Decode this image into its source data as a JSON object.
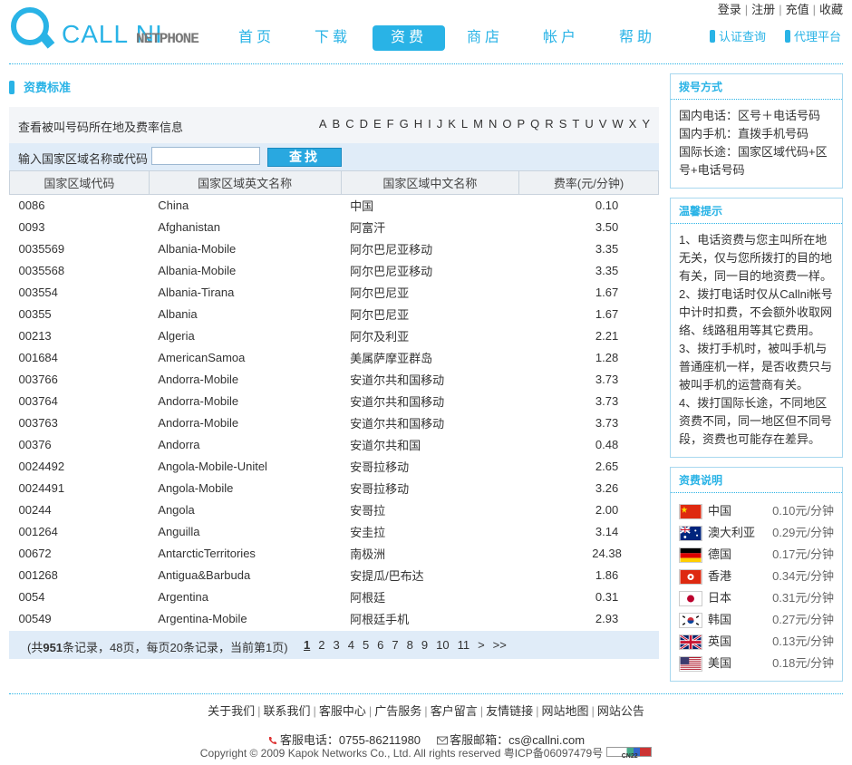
{
  "logo": {
    "text": "CALL NI",
    "sub": "NETPHONE"
  },
  "topnav": [
    "登录",
    "注册",
    "充值",
    "收藏"
  ],
  "mainnav": [
    {
      "label": "首页",
      "active": false
    },
    {
      "label": "下载",
      "active": false
    },
    {
      "label": "资费",
      "active": true
    },
    {
      "label": "商店",
      "active": false
    },
    {
      "label": "帐户",
      "active": false
    },
    {
      "label": "帮助",
      "active": false
    }
  ],
  "quicklinks": [
    "认证查询",
    "代理平台"
  ],
  "main": {
    "title": "资费标准",
    "lookup_label": "查看被叫号码所在地及费率信息",
    "letters": [
      "A",
      "B",
      "C",
      "D",
      "E",
      "F",
      "G",
      "H",
      "I",
      "J",
      "K",
      "L",
      "M",
      "N",
      "O",
      "P",
      "Q",
      "R",
      "S",
      "T",
      "U",
      "V",
      "W",
      "X",
      "Y"
    ],
    "search_label": "输入国家区域名称或代码",
    "search_value": "",
    "search_button": "查找",
    "columns": [
      "国家区域代码",
      "国家区域英文名称",
      "国家区域中文名称",
      "费率(元/分钟)"
    ],
    "rows": [
      [
        "0086",
        "China",
        "中国",
        "0.10"
      ],
      [
        "0093",
        "Afghanistan",
        "阿富汗",
        "3.50"
      ],
      [
        "0035569",
        "Albania-Mobile",
        "阿尔巴尼亚移动",
        "3.35"
      ],
      [
        "0035568",
        "Albania-Mobile",
        "阿尔巴尼亚移动",
        "3.35"
      ],
      [
        "003554",
        "Albania-Tirana",
        "阿尔巴尼亚",
        "1.67"
      ],
      [
        "00355",
        "Albania",
        "阿尔巴尼亚",
        "1.67"
      ],
      [
        "00213",
        "Algeria",
        "阿尔及利亚",
        "2.21"
      ],
      [
        "001684",
        "AmericanSamoa",
        "美属萨摩亚群岛",
        "1.28"
      ],
      [
        "003766",
        "Andorra-Mobile",
        "安道尔共和国移动",
        "3.73"
      ],
      [
        "003764",
        "Andorra-Mobile",
        "安道尔共和国移动",
        "3.73"
      ],
      [
        "003763",
        "Andorra-Mobile",
        "安道尔共和国移动",
        "3.73"
      ],
      [
        "00376",
        "Andorra",
        "安道尔共和国",
        "0.48"
      ],
      [
        "0024492",
        "Angola-Mobile-Unitel",
        "安哥拉移动",
        "2.65"
      ],
      [
        "0024491",
        "Angola-Mobile",
        "安哥拉移动",
        "3.26"
      ],
      [
        "00244",
        "Angola",
        "安哥拉",
        "2.00"
      ],
      [
        "001264",
        "Anguilla",
        "安圭拉",
        "3.14"
      ],
      [
        "00672",
        "AntarcticTerritories",
        "南极洲",
        "24.38"
      ],
      [
        "001268",
        "Antigua&Barbuda",
        "安提瓜/巴布达",
        "1.86"
      ],
      [
        "0054",
        "Argentina",
        "阿根廷",
        "0.31"
      ],
      [
        "00549",
        "Argentina-Mobile",
        "阿根廷手机",
        "2.93"
      ]
    ],
    "pager": {
      "info_prefix": "(共",
      "total": "951",
      "info_suffix": "条记录，48页，每页20条记录，当前第1页)",
      "pages": [
        "1",
        "2",
        "3",
        "4",
        "5",
        "6",
        "7",
        "8",
        "9",
        "10",
        "11",
        ">",
        ">>"
      ],
      "current": "1"
    }
  },
  "sidebar": {
    "dial": {
      "title": "拨号方式",
      "lines": [
        "国内电话：区号＋电话号码",
        "国内手机：直拨手机号码",
        "国际长途：国家区域代码+区号+电话号码"
      ]
    },
    "tips": {
      "title": "温馨提示",
      "lines": [
        "1、电话资费与您主叫所在地无关，仅与您所拨打的目的地有关，同一目的地资费一样。",
        "2、拨打电话时仅从Callni帐号中计时扣费，不会额外收取网络、线路租用等其它费用。",
        "3、拨打手机时，被叫手机与普通座机一样，是否收费只与被叫手机的运营商有关。",
        "4、拨打国际长途，不同地区资费不同，同一地区但不同号段，资费也可能存在差异。"
      ]
    },
    "rates": {
      "title": "资费说明",
      "items": [
        {
          "flag": "cn-flag-icon",
          "name": "中国",
          "rate": "0.10元/分钟"
        },
        {
          "flag": "au-flag-icon",
          "name": "澳大利亚",
          "rate": "0.29元/分钟"
        },
        {
          "flag": "de-flag-icon",
          "name": "德国",
          "rate": "0.17元/分钟"
        },
        {
          "flag": "hk-flag-icon",
          "name": "香港",
          "rate": "0.34元/分钟"
        },
        {
          "flag": "jp-flag-icon",
          "name": "日本",
          "rate": "0.31元/分钟"
        },
        {
          "flag": "kr-flag-icon",
          "name": "韩国",
          "rate": "0.27元/分钟"
        },
        {
          "flag": "uk-flag-icon",
          "name": "英国",
          "rate": "0.13元/分钟"
        },
        {
          "flag": "us-flag-icon",
          "name": "美国",
          "rate": "0.18元/分钟"
        }
      ]
    }
  },
  "footer": {
    "links": [
      "关于我们",
      "联系我们",
      "客服中心",
      "广告服务",
      "客户留言",
      "友情链接",
      "网站地图",
      "网站公告"
    ],
    "phone_label": "客服电话：0755-86211980",
    "email_label": "客服邮箱：cs@callni.com",
    "copyright": "Copyright © 2009 Kapok Networks Co., Ltd. All rights reserved 粤ICP备06097479号",
    "badge": "CN22"
  },
  "colors": {
    "accent": "#29b3e6",
    "band": "#e0ecf8"
  }
}
